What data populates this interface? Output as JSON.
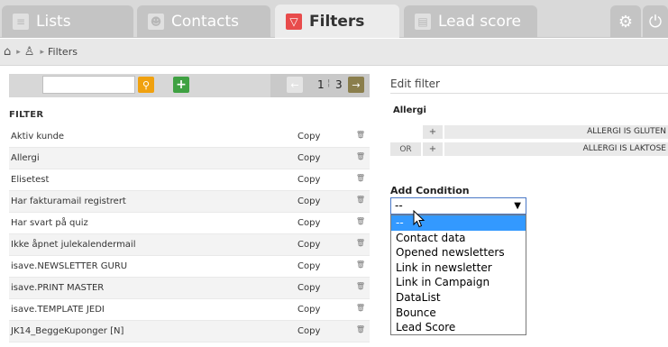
{
  "tabs": [
    {
      "label": "Lists",
      "icon": "list-icon"
    },
    {
      "label": "Contacts",
      "icon": "contact-icon"
    },
    {
      "label": "Filters",
      "icon": "filter-icon",
      "active": true
    },
    {
      "label": "Lead score",
      "icon": "lead-score-icon"
    }
  ],
  "breadcrumb": {
    "items": [
      "Filters"
    ]
  },
  "pager": {
    "current": "1",
    "total": "3"
  },
  "list": {
    "header": "FILTER",
    "rows": [
      {
        "name": "Aktiv kunde",
        "copy": "Copy"
      },
      {
        "name": "Allergi",
        "copy": "Copy"
      },
      {
        "name": "Elisetest",
        "copy": "Copy"
      },
      {
        "name": "Har fakturamail registrert",
        "copy": "Copy"
      },
      {
        "name": "Har svart på quiz",
        "copy": "Copy"
      },
      {
        "name": "Ikke åpnet julekalendermail",
        "copy": "Copy"
      },
      {
        "name": "isave.NEWSLETTER GURU",
        "copy": "Copy"
      },
      {
        "name": "isave.PRINT MASTER",
        "copy": "Copy"
      },
      {
        "name": "isave.TEMPLATE JEDI",
        "copy": "Copy"
      },
      {
        "name": "JK14_BeggeKuponger [N]",
        "copy": "Copy"
      }
    ]
  },
  "edit": {
    "title": "Edit filter",
    "filter_name": "Allergi",
    "conditions": [
      {
        "operator": "",
        "text": "ALLERGI IS GLUTEN"
      },
      {
        "operator": "OR",
        "text": "ALLERGI IS LAKTOSE"
      }
    ],
    "add_condition_label": "Add Condition",
    "select_value": "--",
    "options": [
      "--",
      "Contact data",
      "Opened newsletters",
      "Link in newsletter",
      "Link in Campaign",
      "DataList",
      "Bounce",
      "Lead Score"
    ]
  },
  "colors": {
    "active_tab_icon": "#e84b4b",
    "search_button": "#f0a10f",
    "add_button": "#3fa142",
    "selected_option": "#3399ff"
  }
}
